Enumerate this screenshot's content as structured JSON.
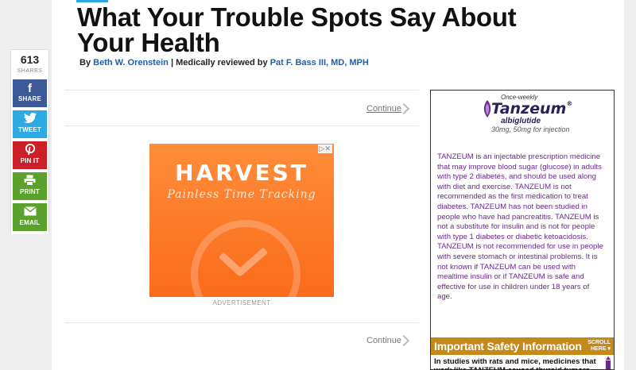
{
  "article": {
    "title": "What Your Trouble Spots Say About Your Health",
    "byline_prefix": "By",
    "author": "Beth W. Orenstein",
    "separator": "|",
    "reviewed_prefix": "Medically reviewed by",
    "reviewer": "Pat F. Bass III, MD, MPH"
  },
  "share": {
    "count": "613",
    "count_label": "SHARES",
    "buttons": [
      {
        "label": "SHARE",
        "icon": "f"
      },
      {
        "label": "TWEET",
        "icon": "twitter-bird"
      },
      {
        "label": "PIN IT",
        "icon": "p"
      },
      {
        "label": "PRINT",
        "icon": "printer"
      },
      {
        "label": "EMAIL",
        "icon": "envelope"
      }
    ]
  },
  "nav": {
    "continue_label": "Continue"
  },
  "ad": {
    "brand": "HARVEST",
    "tagline": "Painless Time Tracking",
    "choices_icon": "▷✕",
    "label": "ADVERTISEMENT"
  },
  "sidebar_ad": {
    "once_weekly": "Once-weekly",
    "brand": "Tanzeum",
    "reg": "®",
    "generic": "albiglutide",
    "dose": "30mg, 50mg for injection",
    "body": "TANZEUM is an injectable prescription medicine that may improve blood sugar (glucose) in adults with type 2 diabetes, and should be used along with diet and exercise. TANZEUM is not recommended as the first medication to treat diabetes. TANZEUM has not been studied in people who have had pancreatitis. TANZEUM is not a substitute for insulin and is not for people with type 1 diabetes or diabetic ketoacidosis. TANZEUM is not recommended for use in people with severe stomach or intestinal problems. It is not known if TANZEUM can be used with mealtime insulin or if TANZEUM is safe and effective for use in children under 18 years of age.",
    "isi_heading": "Important Safety Information",
    "scroll_label_1": "SCROLL",
    "scroll_label_2": "HERE ▾",
    "isi_text": "In studies with rats and mice, medicines that work like TANZEUM caused thyroid tumors,",
    "colors": {
      "text": "#6a2a8c",
      "isi_bar": "#c38a1a",
      "brand": "#2b2055"
    }
  },
  "colors": {
    "facebook": "#3b5998",
    "twitter": "#2caae1",
    "pinterest": "#cb2027",
    "print_email": "#5aa22b",
    "link": "#1e5faa",
    "ad_orange": "#f96b1b"
  }
}
